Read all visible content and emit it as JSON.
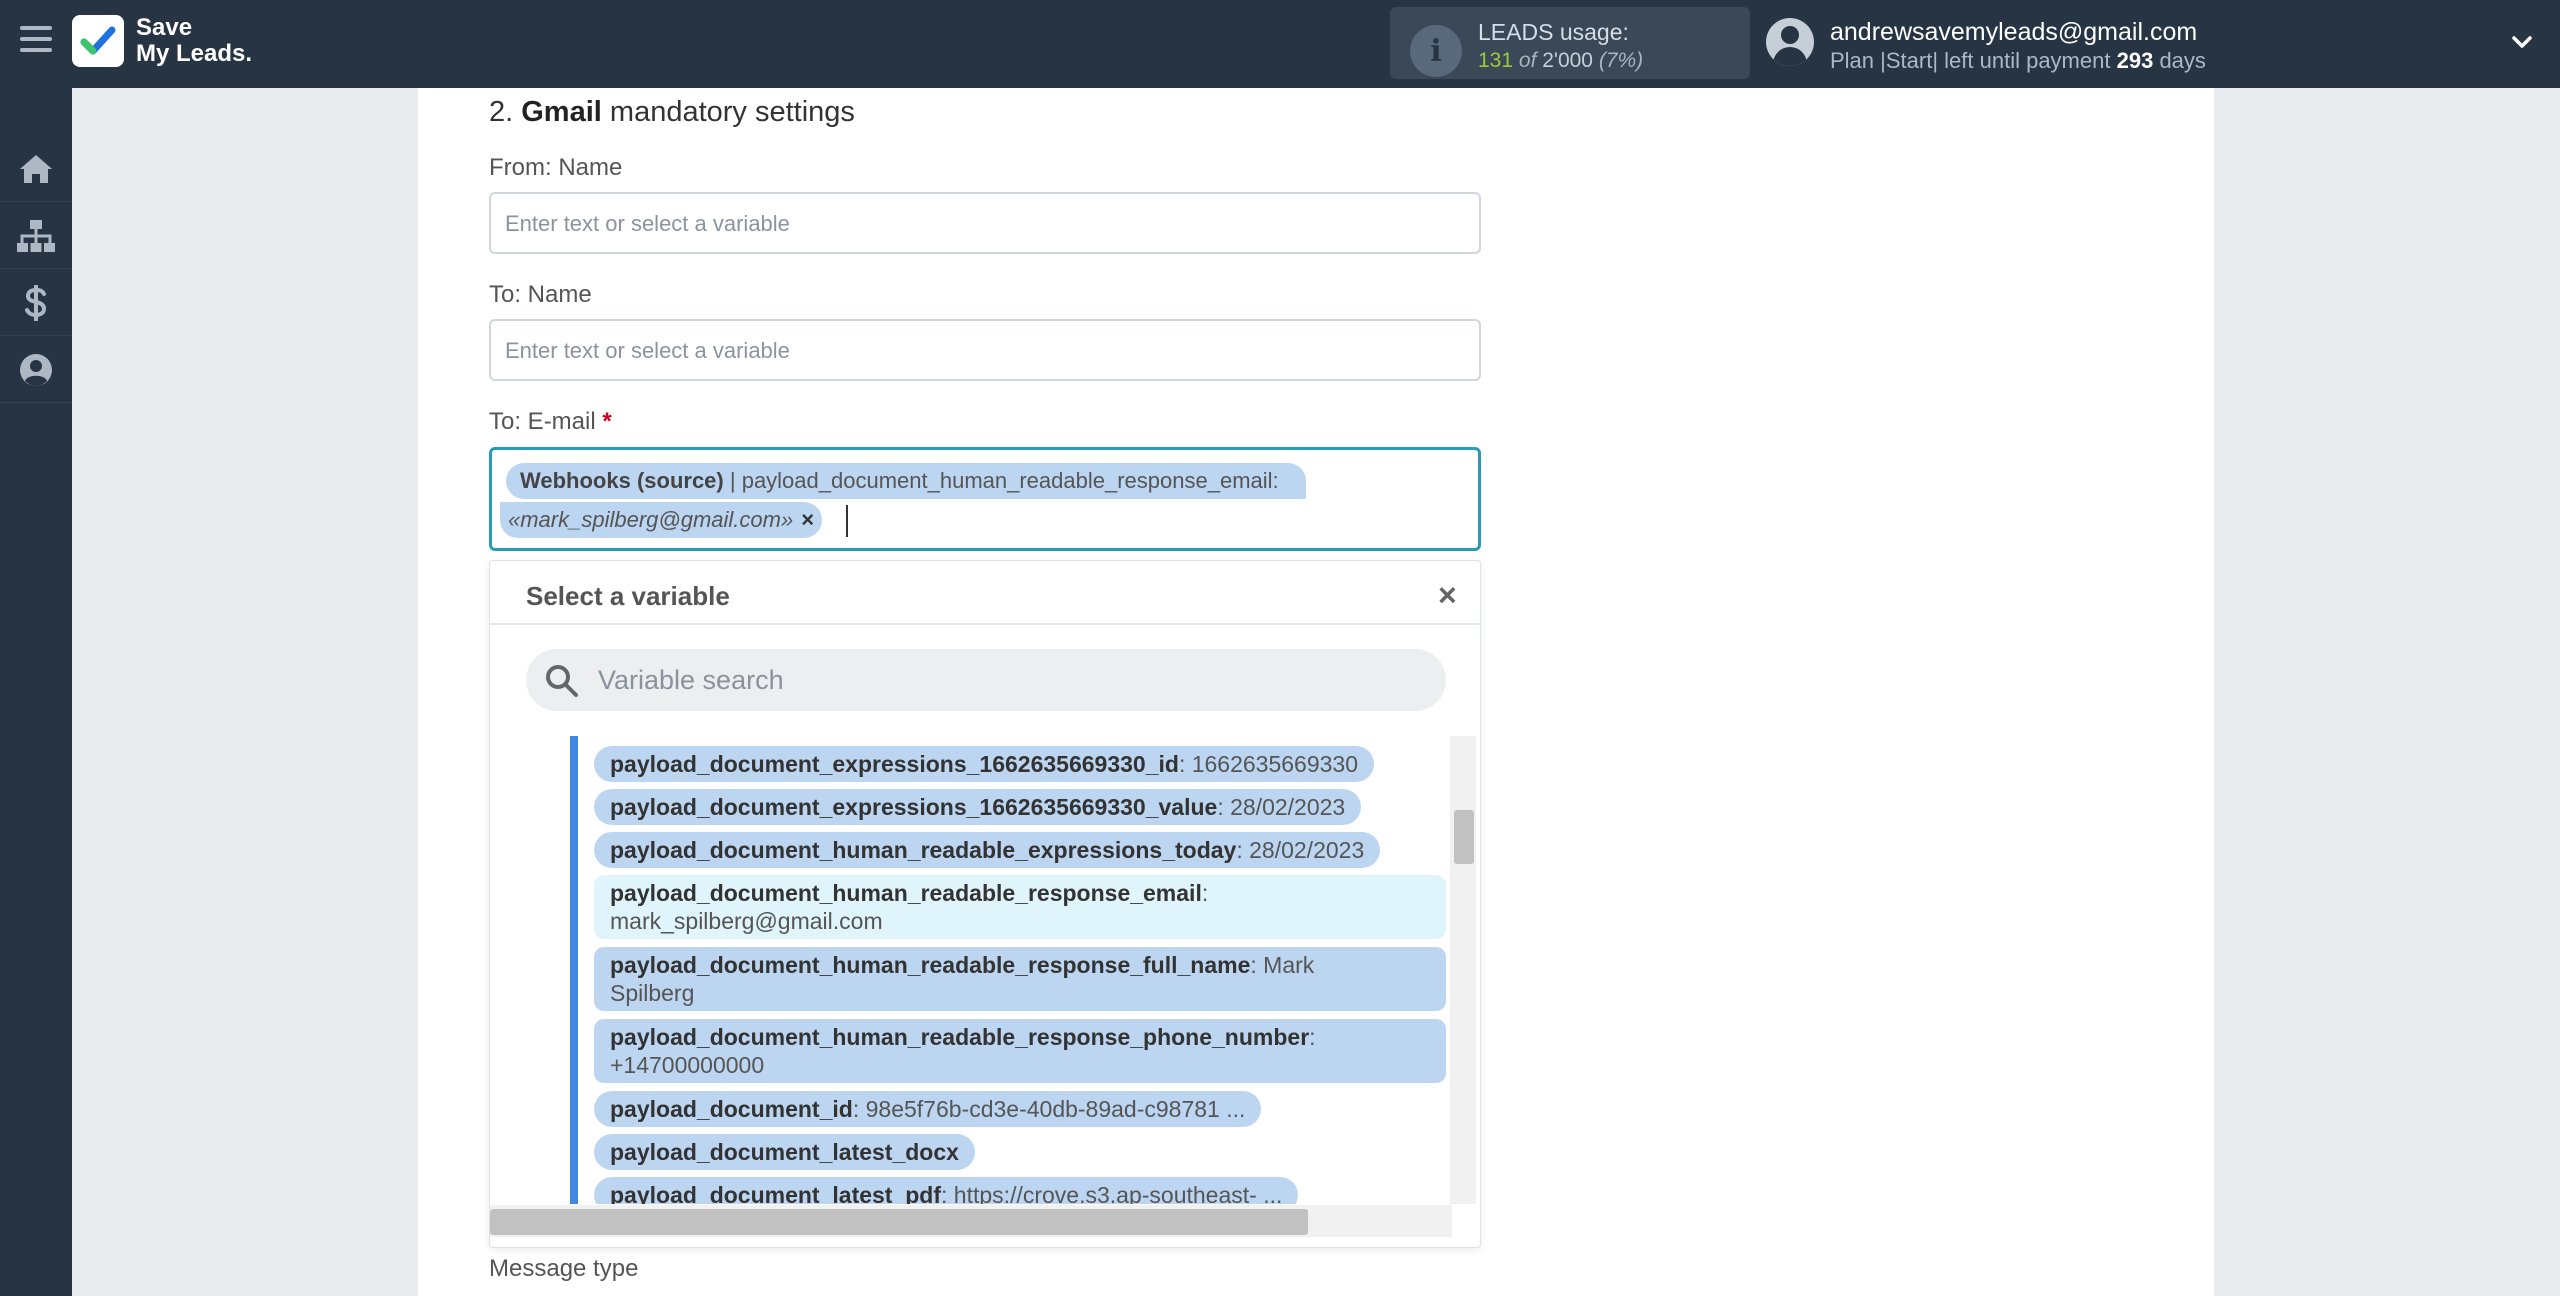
{
  "brand": {
    "line1": "Save",
    "line2": "My Leads."
  },
  "usage": {
    "title": "LEADS usage:",
    "used": "131",
    "of": "of",
    "total": "2'000",
    "percent": "(7%)"
  },
  "account": {
    "email": "andrewsavemyleads@gmail.com",
    "plan_prefix": "Plan |Start| left until payment",
    "days": "293",
    "days_suffix": "days"
  },
  "section": {
    "number": "2.",
    "service": "Gmail",
    "title_rest": "mandatory settings"
  },
  "fields": {
    "from_name": {
      "label": "From: Name",
      "placeholder": "Enter text or select a variable"
    },
    "to_name": {
      "label": "To: Name",
      "placeholder": "Enter text or select a variable"
    },
    "to_email": {
      "label": "To: E-mail",
      "required_mark": "*",
      "chip_source": "Webhooks (source)",
      "chip_field": "| payload_document_human_readable_response_email:",
      "chip_value": "«mark_spilberg@gmail.com»",
      "chip_remove": "×"
    }
  },
  "dropdown": {
    "title": "Select a variable",
    "close": "×",
    "search_placeholder": "Variable search",
    "items": [
      {
        "key": "payload_document_expressions_1662635669330_id",
        "value": ": 1662635669330"
      },
      {
        "key": "payload_document_expressions_1662635669330_value",
        "value": ": 28/02/2023"
      },
      {
        "key": "payload_document_human_readable_expressions_today",
        "value": ": 28/02/2023"
      },
      {
        "key": "payload_document_human_readable_response_email",
        "value": ":",
        "value2": "mark_spilberg@gmail.com"
      },
      {
        "key": "payload_document_human_readable_response_full_name",
        "value": ": Mark",
        "value2": "Spilberg"
      },
      {
        "key": "payload_document_human_readable_response_phone_number",
        "value": ":",
        "value2": "+14700000000"
      },
      {
        "key": "payload_document_id",
        "value": ": 98e5f76b-cd3e-40db-89ad-c98781 ..."
      },
      {
        "key": "payload_document_latest_docx",
        "value": ""
      },
      {
        "key": "payload_document_latest_pdf",
        "value": ": https://crove.s3.ap-southeast- ..."
      }
    ]
  },
  "message_type": {
    "label": "Message type"
  }
}
